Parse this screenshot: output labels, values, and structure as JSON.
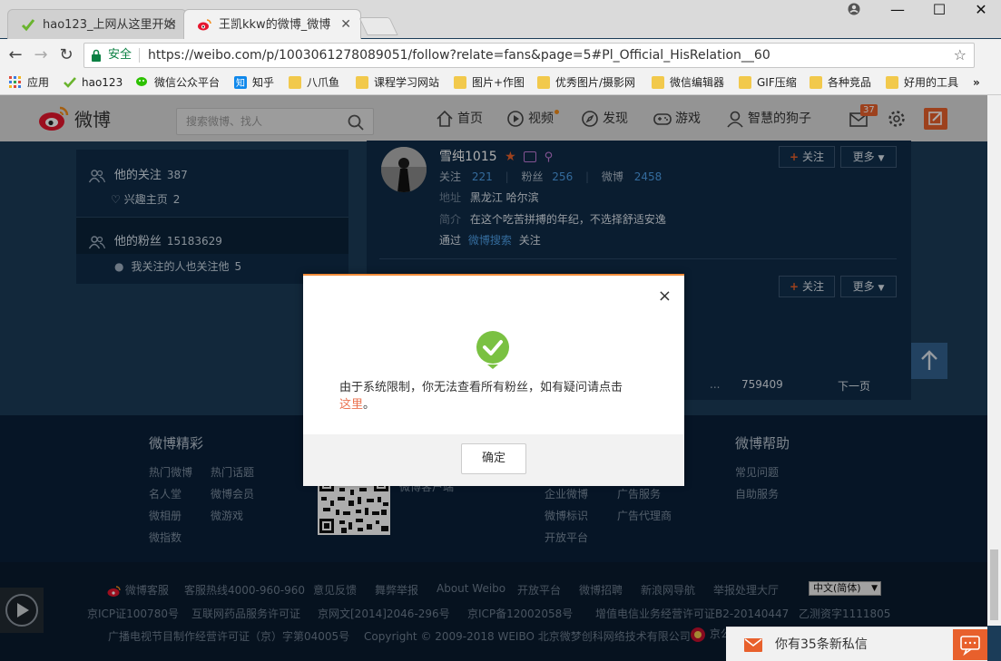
{
  "browser": {
    "tabs": [
      {
        "title": "hao123_上网从这里开始",
        "active": false
      },
      {
        "title": "王凯kkw的微博_微博",
        "active": true
      }
    ],
    "omnibox": {
      "secure_label": "安全",
      "url": "https://weibo.com/p/1003061278089051/follow?relate=fans&page=5#Pl_Official_HisRelation__60"
    },
    "bookmarks": [
      {
        "label": "应用",
        "icon": "apps-grid-icon"
      },
      {
        "label": "hao123",
        "icon": "hao123-icon"
      },
      {
        "label": "微信公众平台",
        "icon": "wechat-icon"
      },
      {
        "label": "知乎",
        "icon": "zhihu-icon"
      },
      {
        "label": "八爪鱼",
        "icon": "folder-icon"
      },
      {
        "label": "课程学习网站",
        "icon": "folder-icon"
      },
      {
        "label": "图片+作图",
        "icon": "folder-icon"
      },
      {
        "label": "优秀图片/摄影网",
        "icon": "folder-icon"
      },
      {
        "label": "微信编辑器",
        "icon": "folder-icon"
      },
      {
        "label": "GIF压缩",
        "icon": "folder-icon"
      },
      {
        "label": "各种竞品",
        "icon": "folder-icon"
      },
      {
        "label": "好用的工具",
        "icon": "folder-icon"
      }
    ],
    "bookmarks_overflow": "»"
  },
  "weibo_nav": {
    "logo_text": "微博",
    "search_placeholder": "搜索微博、找人",
    "items": [
      {
        "label": "首页",
        "icon": "home-icon"
      },
      {
        "label": "视频",
        "icon": "video-icon"
      },
      {
        "label": "发现",
        "icon": "discover-icon"
      },
      {
        "label": "游戏",
        "icon": "game-icon"
      },
      {
        "label": "智慧的狗子",
        "icon": "user-icon"
      }
    ],
    "message_count": "37"
  },
  "left_panel": {
    "follow_label": "他的关注",
    "follow_count": "387",
    "interest_label": "兴趣主页",
    "interest_count": "2",
    "fans_label": "他的粉丝",
    "fans_count": "15183629",
    "mutual_label": "我关注的人也关注他",
    "mutual_count": "5"
  },
  "fan_item": {
    "name": "雪纯1015",
    "follow_label": "关注",
    "follow_count": "221",
    "fans_label": "粉丝",
    "fans_count": "256",
    "weibo_label": "微博",
    "weibo_count": "2458",
    "address_label": "地址",
    "address": "黑龙江 哈尔滨",
    "bio_label": "简介",
    "bio": "在这个吃苦拼搏的年纪，不选择舒适安逸",
    "via_prefix": "通过",
    "via_link": "微博搜索",
    "via_suffix": "关注"
  },
  "actions": {
    "follow_button": "关注",
    "follow_plus": "+",
    "more_button": "更多"
  },
  "pager": {
    "ellipsis": "...",
    "last_page": "759409",
    "next_label": "下一页"
  },
  "footer": {
    "col1_title": "微博精彩",
    "col1_links": [
      "热门微博",
      "热门话题",
      "名人堂",
      "微博会员",
      "微相册",
      "微游戏",
      "微指数"
    ],
    "col2_link": "微博客户端",
    "col3_links": [
      "企业微博",
      "广告服务",
      "微博标识",
      "广告代理商",
      "开放平台"
    ],
    "col4_title": "微博帮助",
    "col4_links": [
      "常见问题",
      "自助服务"
    ],
    "bottom_row1": [
      "微博客服",
      "客服热线4000-960-960",
      "意见反馈",
      "舞弊举报",
      "About Weibo",
      "开放平台",
      "微博招聘",
      "新浪网导航",
      "举报处理大厅"
    ],
    "language": "中文(简体)",
    "bottom_row2": [
      "京ICP证100780号",
      "互联网药品服务许可证",
      "京网文[2014]2046-296号",
      "京ICP备12002058号",
      "增值电信业务经营许可证B2-20140447",
      "乙测资字1111805"
    ],
    "bottom_row3": [
      "广播电视节目制作经营许可证（京）字第04005号",
      "Copyright © 2009-2018 WEIBO 北京微梦创科网络技术有限公司",
      "京公"
    ]
  },
  "message_bar": {
    "text": "你有35条新私信"
  },
  "dialog": {
    "message": "由于系统限制，你无法查看所有粉丝，如有疑问请点击",
    "link_text": "这里",
    "period": "。",
    "ok_label": "确定",
    "close_label": "×"
  },
  "colors": {
    "accent_orange": "#eb7350",
    "check_green": "#7ac142",
    "weibo_red": "#e6162d",
    "link_blue": "#4d9ee6"
  }
}
